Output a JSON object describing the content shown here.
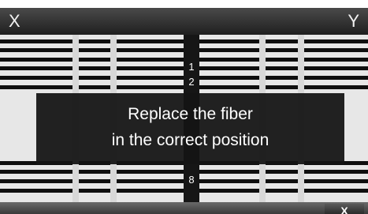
{
  "header": {
    "left_label": "X",
    "right_label": "Y"
  },
  "fiber_numbers": {
    "top_1": "1",
    "top_2": "2",
    "bottom": "8"
  },
  "message": {
    "line1": "Replace the fiber",
    "line2": "in the correct position"
  },
  "footer": {
    "close_label": "X"
  }
}
